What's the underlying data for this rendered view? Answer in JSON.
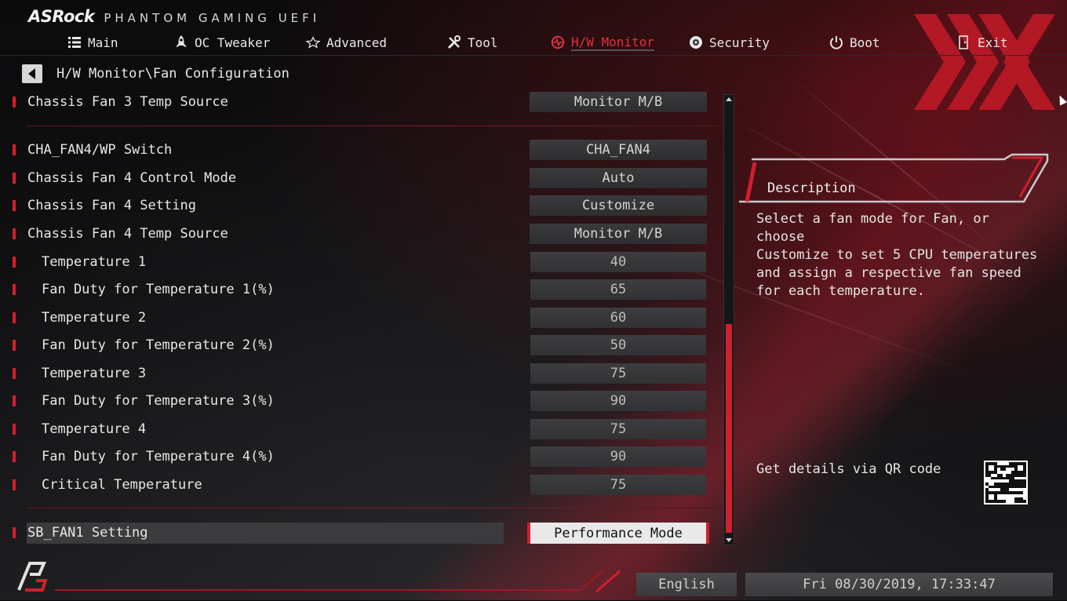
{
  "brand": {
    "logo": "ASRock",
    "subtitle": "PHANTOM GAMING UEFI"
  },
  "nav": [
    {
      "label": "Main",
      "icon": "list-icon"
    },
    {
      "label": "OC Tweaker",
      "icon": "rocket-icon"
    },
    {
      "label": "Advanced",
      "icon": "star-icon"
    },
    {
      "label": "Tool",
      "icon": "tools-icon"
    },
    {
      "label": "H/W Monitor",
      "icon": "monitor-icon",
      "active": true
    },
    {
      "label": "Security",
      "icon": "shield-icon"
    },
    {
      "label": "Boot",
      "icon": "power-icon"
    },
    {
      "label": "Exit",
      "icon": "exit-icon"
    }
  ],
  "breadcrumb": "H/W Monitor\\Fan Configuration",
  "settings": [
    {
      "label": "Chassis Fan 3 Temp Source",
      "value": "Monitor M/B"
    },
    {
      "label": "CHA_FAN4/WP Switch",
      "value": "CHA_FAN4"
    },
    {
      "label": "Chassis Fan 4 Control Mode",
      "value": "Auto"
    },
    {
      "label": "Chassis Fan 4 Setting",
      "value": "Customize"
    },
    {
      "label": "Chassis Fan 4 Temp Source",
      "value": "Monitor M/B"
    },
    {
      "label": "Temperature 1",
      "value": "40"
    },
    {
      "label": "Fan Duty for Temperature 1(%)",
      "value": "65"
    },
    {
      "label": "Temperature 2",
      "value": "60"
    },
    {
      "label": "Fan Duty for Temperature 2(%)",
      "value": "50"
    },
    {
      "label": "Temperature 3",
      "value": "75"
    },
    {
      "label": "Fan Duty for Temperature 3(%)",
      "value": "90"
    },
    {
      "label": "Temperature 4",
      "value": "75"
    },
    {
      "label": "Fan Duty for Temperature 4(%)",
      "value": "90"
    },
    {
      "label": "Critical Temperature",
      "value": "75"
    },
    {
      "label": "SB_FAN1 Setting",
      "value": "Performance Mode"
    }
  ],
  "description": {
    "title": "Description",
    "text": "Select a fan mode for Fan, or choose\nCustomize to set 5 CPU temperatures\nand assign a respective fan speed\nfor each temperature.",
    "qr_label": "Get details via QR code"
  },
  "footer": {
    "language": "English",
    "datetime": "Fri 08/30/2019, 17:33:47"
  },
  "colors": {
    "accent": "#d11f2e",
    "panel": "#3a3a3c",
    "text": "#e6e6e6"
  }
}
